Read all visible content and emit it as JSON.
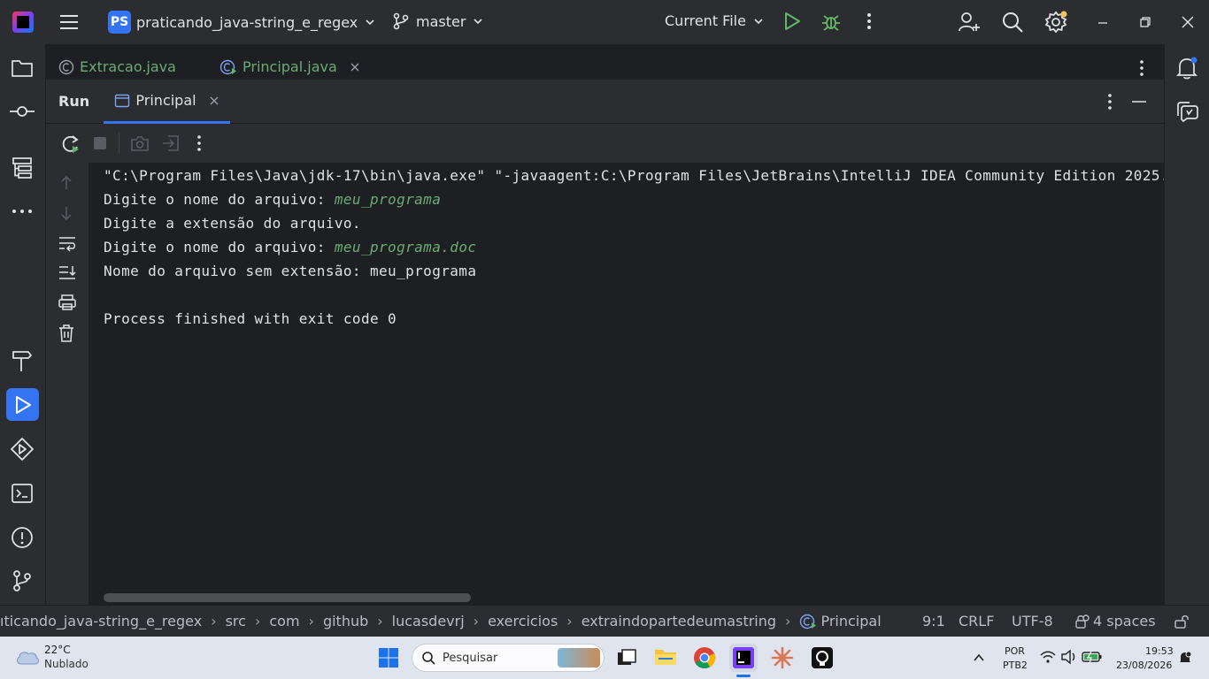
{
  "titlebar": {
    "project_badge": "PS",
    "project_name": "praticando_java-string_e_regex",
    "branch": "master",
    "run_config": "Current File"
  },
  "editor_tabs": [
    {
      "label": "Extracao.java"
    },
    {
      "label": "Principal.java"
    }
  ],
  "run_panel": {
    "title": "Run",
    "tab_label": "Principal"
  },
  "console": {
    "line1": "\"C:\\Program Files\\Java\\jdk-17\\bin\\java.exe\" \"-javaagent:C:\\Program Files\\JetBrains\\IntelliJ IDEA Community Edition 2025.",
    "line2_prompt": "Digite o nome do arquivo: ",
    "line2_input": "meu_programa",
    "line3": "Digite a extensão do arquivo.",
    "line4_prompt": "Digite o nome do arquivo: ",
    "line4_input": "meu_programa.doc",
    "line5": "Nome do arquivo sem extensão: meu_programa",
    "line6": "Process finished with exit code 0"
  },
  "breadcrumb": [
    "ıticando_java-string_e_regex",
    "src",
    "com",
    "github",
    "lucasdevrj",
    "exercicios",
    "extraindopartedeumastring",
    "Principal"
  ],
  "status": {
    "position": "9:1",
    "line_sep": "CRLF",
    "encoding": "UTF-8",
    "indent": "4 spaces"
  },
  "taskbar": {
    "weather_temp": "22°C",
    "weather_desc": "Nublado",
    "search_placeholder": "Pesquisar",
    "lang1": "POR",
    "lang2": "PTB2",
    "time": "19:53",
    "date": "23/08/2026"
  },
  "colors": {
    "accent": "#3574f0",
    "console_input": "#6aab73",
    "run_green": "#5fb865"
  }
}
